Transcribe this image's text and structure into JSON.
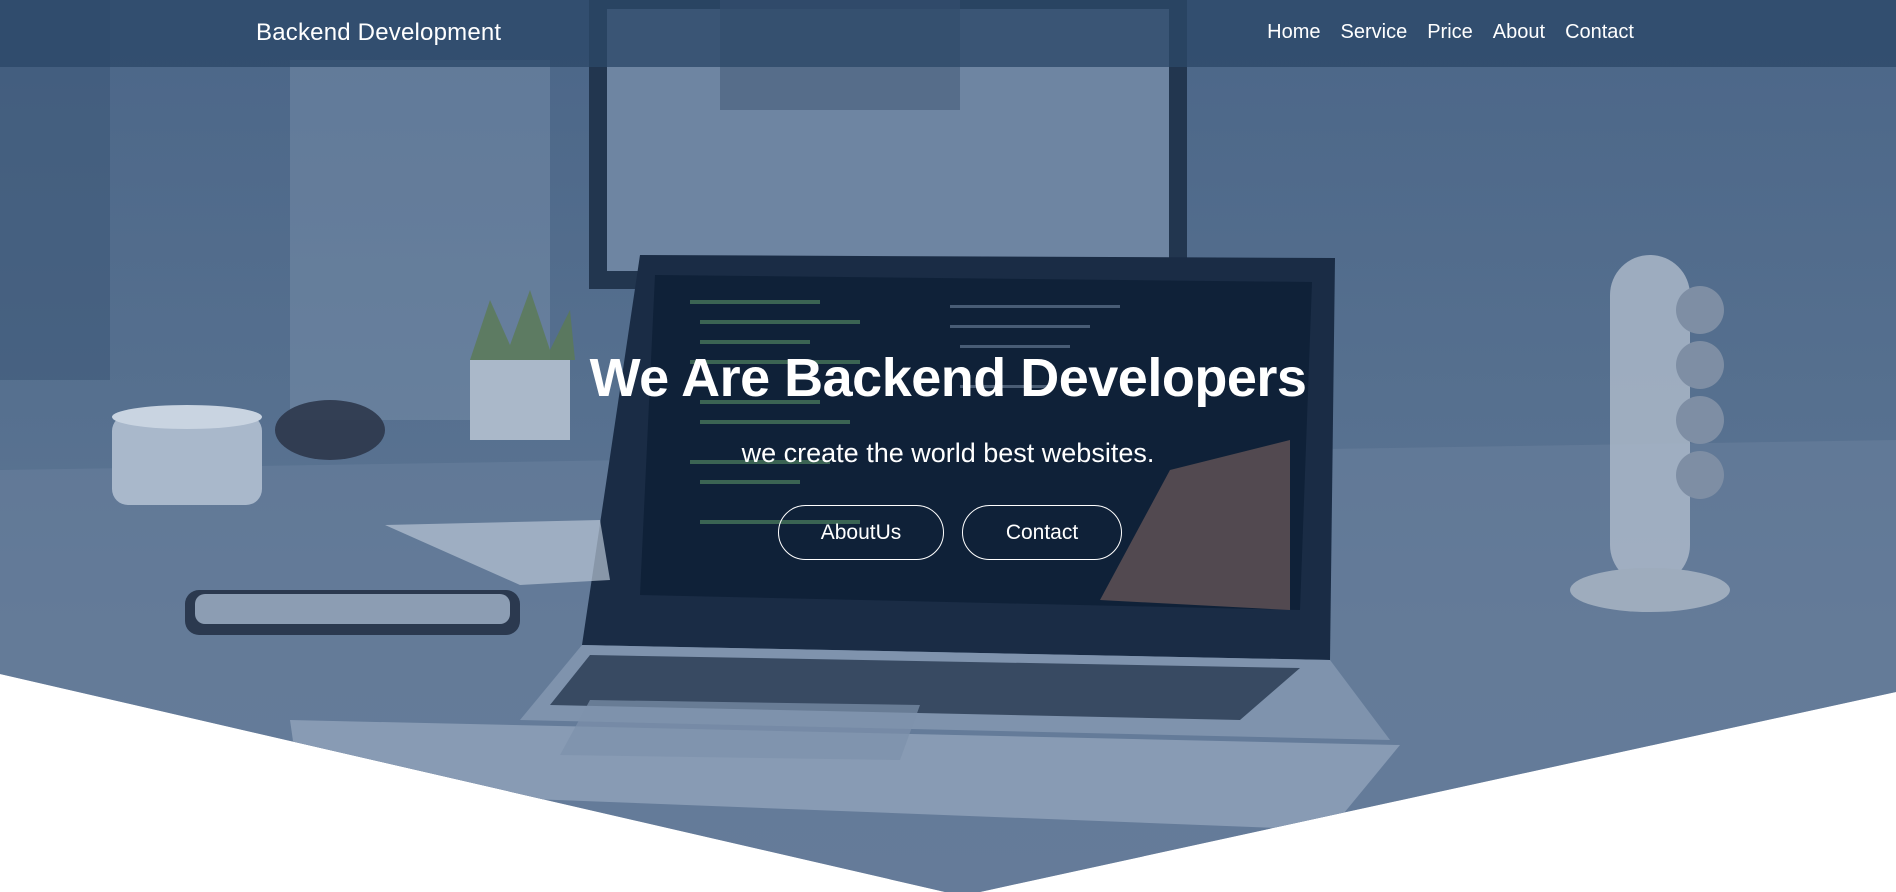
{
  "brand": "Backend Development",
  "nav": {
    "items": [
      "Home",
      "Service",
      "Price",
      "About",
      "Contact"
    ]
  },
  "hero": {
    "headline": "We Are Backend Developers",
    "subline": "we create the world best websites.",
    "buttons": {
      "about": "AboutUs",
      "contact": "Contact"
    }
  },
  "colors": {
    "navbar": "#2c4868",
    "overlay": "#4b6688",
    "text": "#ffffff",
    "page_background": "#ffffff"
  }
}
